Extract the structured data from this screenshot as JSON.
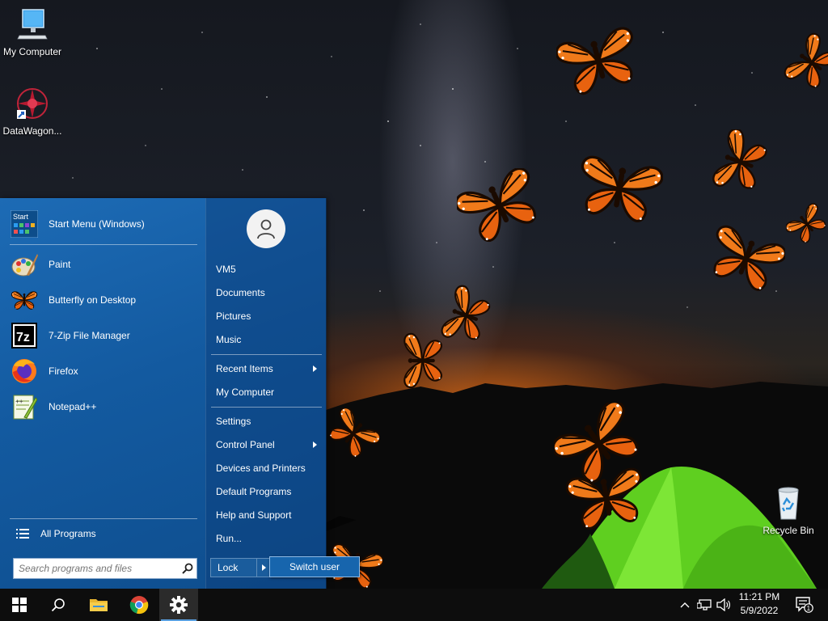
{
  "desktop": {
    "icons": [
      {
        "label": "My Computer",
        "icon": "monitor-icon"
      },
      {
        "label": "DataWagon...",
        "icon": "datawagon-icon"
      },
      {
        "label": "Recycle Bin",
        "icon": "recycle-bin-icon"
      }
    ]
  },
  "start_menu": {
    "pinned": [
      {
        "label": "Start Menu (Windows)",
        "icon": "start-menu-icon"
      }
    ],
    "programs": [
      {
        "label": "Paint",
        "icon": "paint-icon"
      },
      {
        "label": "Butterfly on Desktop",
        "icon": "butterfly-icon"
      },
      {
        "label": "7-Zip File Manager",
        "icon": "7zip-icon"
      },
      {
        "label": "Firefox",
        "icon": "firefox-icon"
      },
      {
        "label": "Notepad++",
        "icon": "notepadpp-icon"
      }
    ],
    "all_programs": "All Programs",
    "search_placeholder": "Search programs and files",
    "right_items": [
      {
        "label": "VM5"
      },
      {
        "label": "Documents"
      },
      {
        "label": "Pictures"
      },
      {
        "label": "Music"
      },
      {
        "label": "Recent Items",
        "submenu": true
      },
      {
        "label": "My Computer"
      },
      {
        "label": "Settings"
      },
      {
        "label": "Control Panel",
        "submenu": true
      },
      {
        "label": "Devices and Printers"
      },
      {
        "label": "Default Programs"
      },
      {
        "label": "Help and Support"
      },
      {
        "label": "Run..."
      }
    ],
    "lock_label": "Lock",
    "switch_user_label": "Switch user"
  },
  "taskbar": {
    "buttons": [
      "windows-start-icon",
      "search-icon",
      "file-explorer-icon",
      "chrome-icon",
      "settings-gear-icon"
    ],
    "active_button": "settings-gear-icon",
    "tray_icons": [
      "chevron-up-icon",
      "network-icon",
      "volume-icon"
    ],
    "time": "11:21 PM",
    "date": "5/9/2022",
    "notification_count": "1"
  },
  "colors": {
    "start_menu_blue": "#135aa0",
    "taskbar": "#0d0d0d",
    "accent": "#5aa0e0",
    "butterfly_orange": "#f07a1a"
  }
}
